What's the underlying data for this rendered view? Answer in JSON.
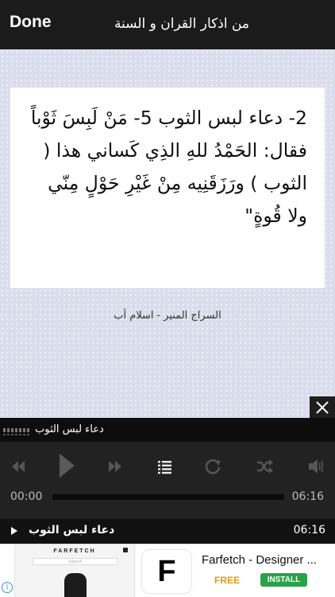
{
  "header": {
    "done_label": "Done",
    "title": "من اذكار القران و السنة"
  },
  "card": {
    "text": "2- دعاء لبس الثوب 5- مَنْ لَبِسَ ثَوْباً فقال: الحَمْدُ للهِ الذِي كَساني هذا ( الثوب ) ورَزَقَنِيه مِنْ غَيْرِ حَوْلٍ مِنّي ولا قُوةٍ\""
  },
  "credit": "السراج المنير - اسلام اَب",
  "player": {
    "track_title": "دعاء لبس الثوب",
    "current_time": "00:00",
    "total_time": "06:16",
    "progress_fraction": 0,
    "now_playing_title": "دعاء لبس الثوب",
    "now_playing_duration": "06:16",
    "icons": [
      "previous-icon",
      "play-icon",
      "next-icon",
      "playlist-icon",
      "repeat-icon",
      "shuffle-icon",
      "volume-icon"
    ]
  },
  "ad": {
    "brand": "FARFETCH",
    "search_placeholder": "Search",
    "logo_letter": "F",
    "app_name": "Farfetch - Designer ...",
    "price": "FREE",
    "install_label": "INSTALL",
    "info_icon": "i"
  },
  "colors": {
    "bar_dark": "#1b1b1b",
    "player_bg": "#222222",
    "install_green": "#2aa24a",
    "price_orange": "#e09a1a",
    "background_pattern": "#d9ddec"
  }
}
